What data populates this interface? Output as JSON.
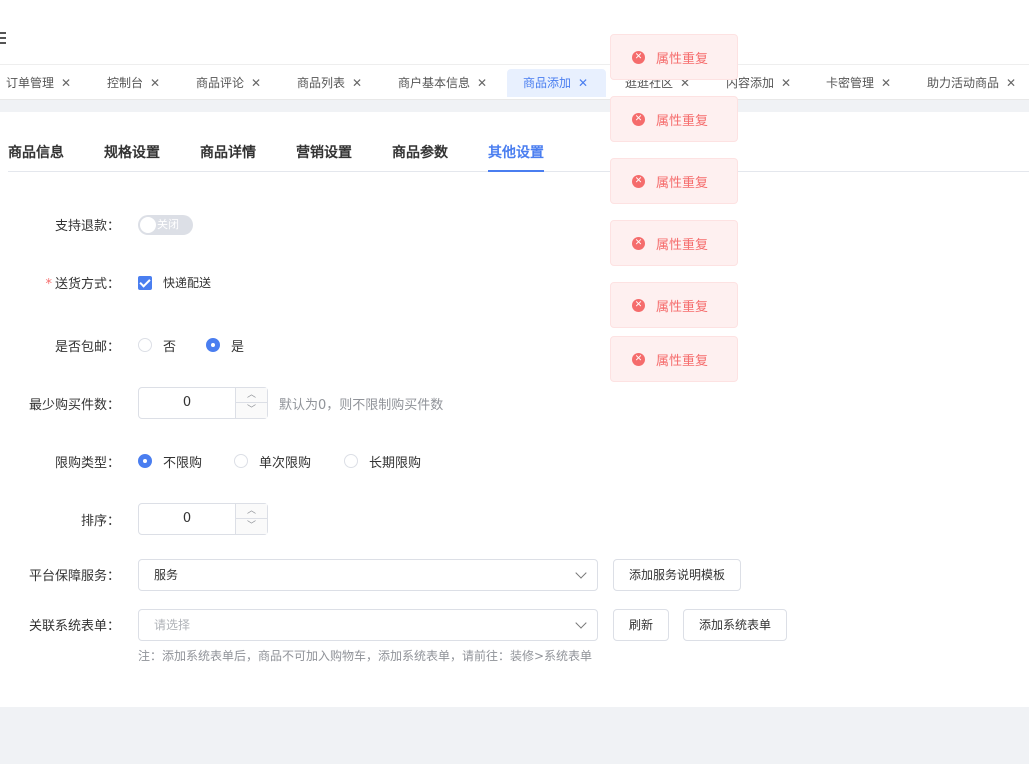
{
  "header": {
    "menu_icon": "hamburger-icon"
  },
  "tabs": [
    {
      "label": "订单管理"
    },
    {
      "label": "控制台"
    },
    {
      "label": "商品评论"
    },
    {
      "label": "商品列表"
    },
    {
      "label": "商户基本信息"
    },
    {
      "label": "商品添加"
    },
    {
      "label": "逛逛社区"
    },
    {
      "label": "内容添加"
    },
    {
      "label": "卡密管理"
    },
    {
      "label": "助力活动商品"
    }
  ],
  "active_tab": "商品添加",
  "subtabs": [
    {
      "label": "商品信息"
    },
    {
      "label": "规格设置"
    },
    {
      "label": "商品详情"
    },
    {
      "label": "营销设置"
    },
    {
      "label": "商品参数"
    },
    {
      "label": "其他设置"
    }
  ],
  "active_subtab": "其他设置",
  "form": {
    "refund": {
      "label": "支持退款：",
      "switch_text": "关闭",
      "enabled": false
    },
    "delivery": {
      "required_mark": "*",
      "label": "送货方式：",
      "option": "快递配送",
      "checked": true
    },
    "free_shipping": {
      "label": "是否包邮：",
      "options": [
        "否",
        "是"
      ],
      "selected": "是"
    },
    "min_purchase": {
      "label": "最少购买件数：",
      "value": "0",
      "hint": "默认为0，则不限制购买件数"
    },
    "limit_type": {
      "label": "限购类型：",
      "options": [
        "不限购",
        "单次限购",
        "长期限购"
      ],
      "selected": "不限购"
    },
    "sort": {
      "label": "排序：",
      "value": "0"
    },
    "guarantee": {
      "label": "平台保障服务：",
      "value": "服务",
      "add_button": "添加服务说明模板"
    },
    "system_form": {
      "label": "关联系统表单：",
      "placeholder": "请选择",
      "refresh_button": "刷新",
      "add_button": "添加系统表单",
      "note": "注：添加系统表单后，商品不可加入购物车，添加系统表单，请前往：装修>系统表单"
    }
  },
  "toasts": [
    {
      "text": "属性重复"
    },
    {
      "text": "属性重复"
    },
    {
      "text": "属性重复"
    },
    {
      "text": "属性重复"
    },
    {
      "text": "属性重复"
    },
    {
      "text": "属性重复"
    }
  ],
  "colors": {
    "primary": "#4a7ef0",
    "error": "#f56c6c",
    "error_bg": "#fef0f0"
  }
}
